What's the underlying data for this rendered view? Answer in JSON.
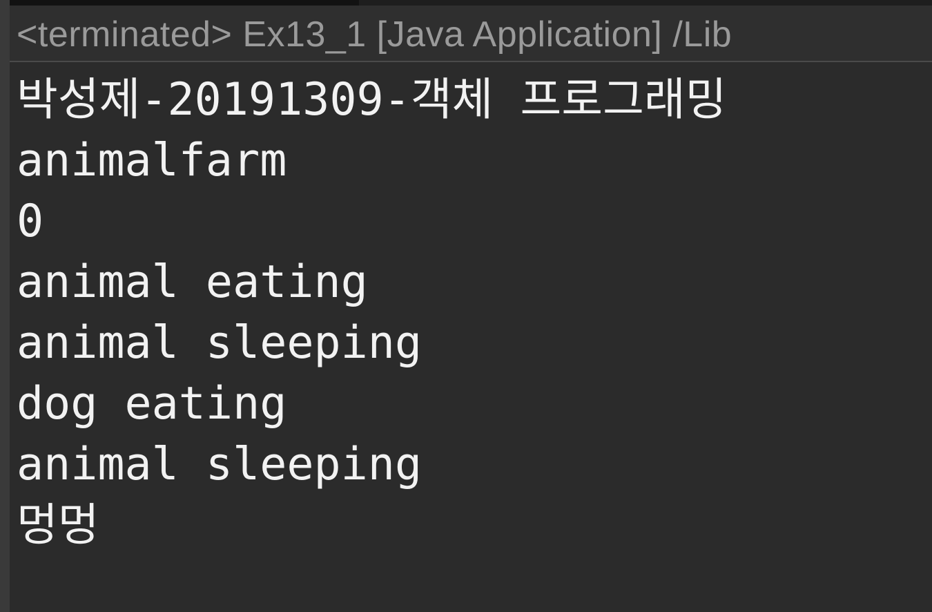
{
  "console": {
    "header": "<terminated> Ex13_1 [Java Application] /Lib",
    "lines": [
      "박성제-20191309-객체 프로그래밍",
      "animalfarm",
      "0",
      "animal eating",
      "animal sleeping",
      "dog eating",
      "animal sleeping",
      "멍멍"
    ]
  },
  "colors": {
    "background": "#2b2b2b",
    "header_background": "#2f2f2f",
    "header_text": "#9a9a9a",
    "output_text": "#f2f2f2"
  }
}
